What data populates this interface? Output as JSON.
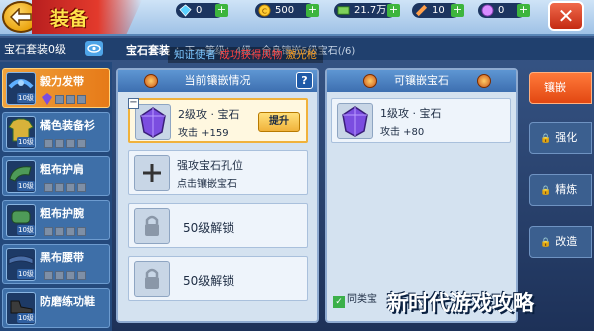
{
  "topbar": {
    "title": "装备",
    "resources": [
      {
        "icon": "diamond-icon",
        "value": "0",
        "color": "#5bd1ff"
      },
      {
        "icon": "gold-coin-icon",
        "value": "500",
        "color": "#ffcc33"
      },
      {
        "icon": "cash-icon",
        "value": "21.7万",
        "color": "#7ed15b"
      },
      {
        "icon": "ticket-icon",
        "value": "10",
        "color": "#ff9f4a"
      },
      {
        "icon": "token-icon",
        "value": "0",
        "color": "#d98cff"
      }
    ]
  },
  "header": {
    "set_level": "宝石套装0级",
    "gem_set_label": "宝石套装",
    "scroll_tip": "：下一等级：4级，全身镶嵌5级宝石(/6)",
    "notify": {
      "part1": "知证使者",
      "part2": "成功获得风物",
      "part3": "激光枪"
    }
  },
  "equipment": [
    {
      "name": "毅力发带",
      "level": "10级",
      "selected": true,
      "icon": "headband-icon"
    },
    {
      "name": "橘色装备衫",
      "level": "10级",
      "selected": false,
      "icon": "shirt-icon"
    },
    {
      "name": "粗布护肩",
      "level": "10级",
      "selected": false,
      "icon": "shoulder-icon"
    },
    {
      "name": "粗布护腕",
      "level": "10级",
      "selected": false,
      "icon": "wrist-icon"
    },
    {
      "name": "黑布腰带",
      "level": "10级",
      "selected": false,
      "icon": "belt-icon"
    },
    {
      "name": "防磨练功鞋",
      "level": "10级",
      "selected": false,
      "icon": "shoes-icon"
    }
  ],
  "current_panel": {
    "title": "当前镶嵌情况",
    "help": "?",
    "slot1": {
      "name": "2级攻 · 宝石",
      "attr": "攻击 +159",
      "button": "提升"
    },
    "slot2": {
      "line1": "强攻宝石孔位",
      "line2": "点击镶嵌宝石"
    },
    "slot3": {
      "text": "50级解锁"
    },
    "slot4": {
      "text": "50级解锁"
    }
  },
  "available_panel": {
    "title": "可镶嵌宝石",
    "gem": {
      "name": "1级攻 · 宝石",
      "attr": "攻击 +80"
    },
    "same_type_label": "同类宝"
  },
  "tabs": [
    {
      "label": "镶嵌",
      "active": true,
      "locked": false
    },
    {
      "label": "强化",
      "active": false,
      "locked": true
    },
    {
      "label": "精炼",
      "active": false,
      "locked": true
    },
    {
      "label": "改造",
      "active": false,
      "locked": true
    }
  ],
  "watermark": "新时代游戏攻略",
  "colors": {
    "accent_orange": "#e67a18",
    "panel_blue": "#3d6fb0",
    "gem_purple": "#7b4de0"
  }
}
